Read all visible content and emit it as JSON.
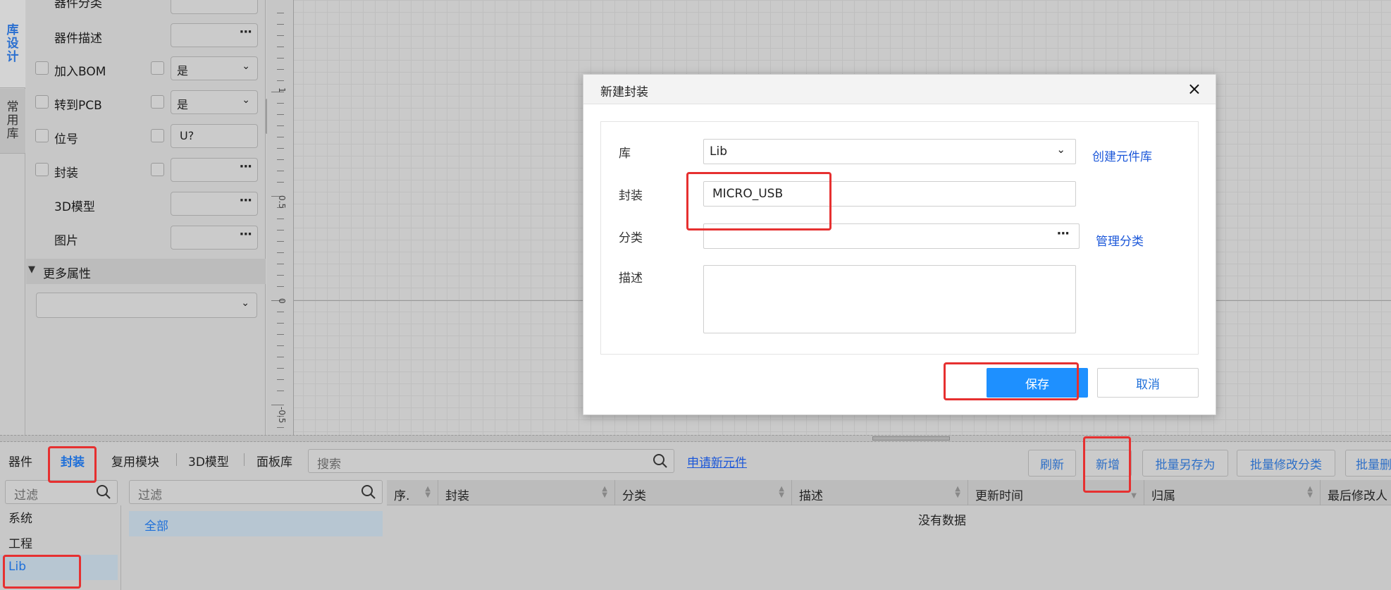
{
  "left_tabs": [
    {
      "label": "库设计",
      "chars": [
        "库",
        "设",
        "计"
      ]
    },
    {
      "label": "常用库",
      "chars": [
        "常",
        "用",
        "库"
      ]
    }
  ],
  "properties": {
    "rows": [
      {
        "label": "器件分类",
        "value": ""
      },
      {
        "label": "器件描述",
        "value": ""
      },
      {
        "label": "加入BOM",
        "value": "是"
      },
      {
        "label": "转到PCB",
        "value": "是"
      },
      {
        "label": "位号",
        "value": "U?"
      },
      {
        "label": "封装",
        "value": ""
      },
      {
        "label": "3D模型",
        "value": ""
      },
      {
        "label": "图片",
        "value": ""
      }
    ],
    "more_section": "更多属性",
    "more_select_value": ""
  },
  "ruler": {
    "labels": [
      "1",
      "0.5",
      "0",
      "-0.5"
    ]
  },
  "modal": {
    "title": "新建封装",
    "close_icon": "×",
    "fields": {
      "lib_label": "库",
      "lib_value": "Lib",
      "create_lib_link": "创建元件库",
      "footprint_label": "封装",
      "footprint_value": "MICRO_USB",
      "category_label": "分类",
      "category_value": "",
      "manage_category_link": "管理分类",
      "desc_label": "描述",
      "desc_value": ""
    },
    "save_label": "保存",
    "cancel_label": "取消"
  },
  "bottom": {
    "tabs": [
      "器件",
      "封装",
      "复用模块",
      "3D模型",
      "面板库"
    ],
    "active_tab": "封装",
    "search_placeholder": "搜索",
    "apply_link": "申请新元件",
    "buttons": [
      "刷新",
      "新增",
      "批量另存为",
      "批量修改分类",
      "批量删"
    ],
    "filter_placeholder": "过滤",
    "filter2_placeholder": "过滤",
    "libraries": [
      "系统",
      "工程",
      "Lib"
    ],
    "selected_library": "Lib",
    "category_all": "全部",
    "columns": [
      "序.",
      "封装",
      "分类",
      "描述",
      "更新时间",
      "归属",
      "最后修改人"
    ],
    "empty_text": "没有数据"
  },
  "colors": {
    "accent": "#1e90ff",
    "link": "#1b57d9",
    "highlight": "#e63030"
  }
}
